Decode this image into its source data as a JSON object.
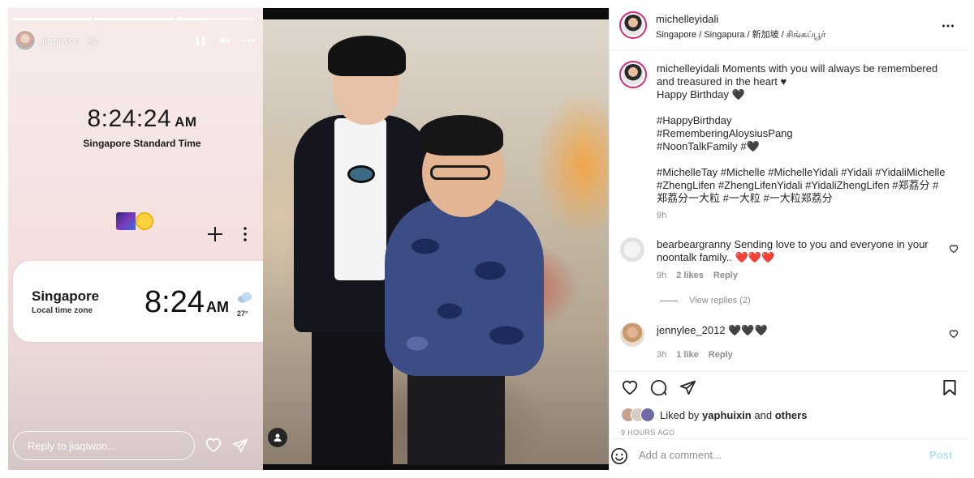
{
  "story": {
    "progress": [
      1.0,
      1.0,
      0.38
    ],
    "username": "jiaqiwoo",
    "time_ago": "2h",
    "clock_time": "8:24:24",
    "clock_ampm": "AM",
    "clock_zone": "Singapore Standard Time",
    "card_city": "Singapore",
    "card_tz": "Local time zone",
    "card_time": "8:24",
    "card_ampm": "AM",
    "card_temp": "27°",
    "reply_placeholder": "Reply to jiaqiwoo..."
  },
  "post": {
    "username": "michelleyidali",
    "location": "Singapore / Singapura / 新加坡 / சிங்கப்பூர்",
    "caption_user": "michelleyidali",
    "caption_lines": [
      "Moments with you will always be remembered and treasured in the heart ♥",
      "Happy Birthday 🖤",
      "",
      "#HappyBirthday",
      "#RememberingAloysiusPang",
      "#NoonTalkFamily #🖤",
      "",
      "#MichelleTay #Michelle #MichelleYidali #Yidali #YidaliMichelle #ZhengLifen #ZhengLifenYidali #YidaliZhengLifen #郑荔分 #郑荔分一大粒 #一大粒 #一大粒郑荔分"
    ],
    "caption_time": "9h",
    "comments": [
      {
        "username": "bearbeargranny",
        "text": "Sending love to you and everyone in your noontalk family..",
        "hearts": "❤️❤️❤️",
        "time": "9h",
        "likes": "2 likes",
        "reply": "Reply"
      },
      {
        "username": "jennylee_2012",
        "text": "",
        "hearts": "🖤🖤🖤",
        "time": "3h",
        "likes": "1 like",
        "reply": "Reply"
      }
    ],
    "view_replies": "View replies (2)",
    "liked_by_prefix": "Liked by",
    "liked_by_user": "yaphuixin",
    "liked_by_and": "and",
    "liked_by_others": "others",
    "posted_ago": "9 HOURS AGO",
    "comment_placeholder": "Add a comment...",
    "post_label": "Post"
  },
  "icons": {
    "pause": "pause-icon",
    "mute": "mute-icon",
    "more": "more-horizontal-icon",
    "heart": "heart-icon",
    "send": "send-icon",
    "comment": "comment-icon",
    "bookmark": "bookmark-icon",
    "emoji": "emoji-icon"
  },
  "colors": {
    "link_blue_disabled": "#b2dffc",
    "secondary_text": "#8e8e8e",
    "heart_red": "#ed4956"
  }
}
